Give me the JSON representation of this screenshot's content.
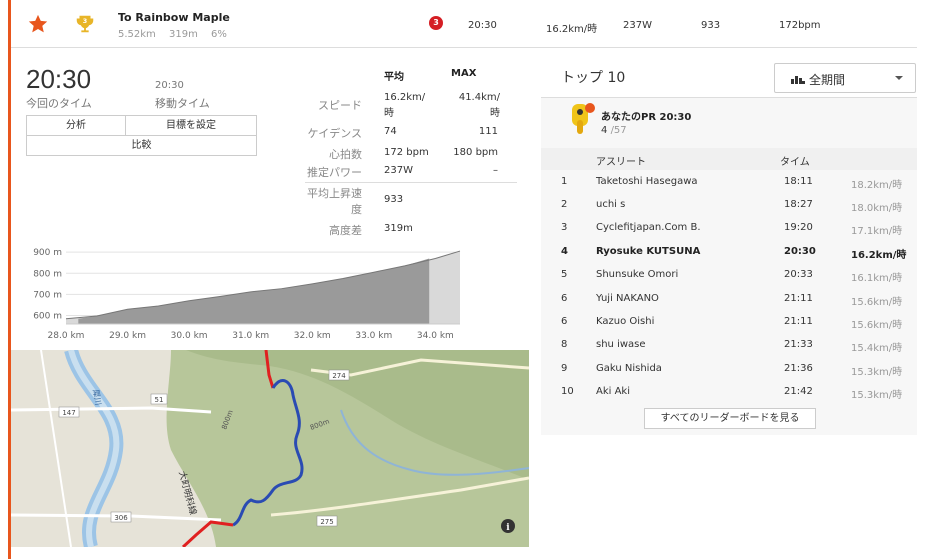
{
  "segment": {
    "name": "To Rainbow Maple",
    "distance": "5.52km",
    "elevation_gain": "319m",
    "grade": "6%",
    "rank": "3",
    "time": "20:30",
    "speed": "16.2km/時",
    "power": "237W",
    "vam": "933",
    "heart_rate": "172bpm"
  },
  "effort": {
    "elapsed_time": "20:30",
    "elapsed_label": "今回のタイム",
    "moving_time": "20:30",
    "moving_label": "移動タイム",
    "buttons": {
      "analysis": "分析",
      "set_goal": "目標を設定",
      "compare": "比較"
    }
  },
  "stats": {
    "header_avg": "平均",
    "header_max": "MAX",
    "rows": [
      {
        "label": "スピード",
        "avg": "16.2km/時",
        "max": "41.4km/時"
      },
      {
        "label": "ケイデンス",
        "avg": "74",
        "max": "111"
      },
      {
        "label": "心拍数",
        "avg": "172 bpm",
        "max": "180 bpm"
      },
      {
        "label": "推定パワー",
        "avg": "237W",
        "max": "–"
      },
      {
        "label": "平均上昇速度",
        "avg": "933",
        "max": ""
      },
      {
        "label": "高度差",
        "avg": "319m",
        "max": ""
      }
    ]
  },
  "chart_data": {
    "type": "area",
    "x": [
      28.0,
      28.5,
      29.0,
      29.5,
      30.0,
      30.5,
      31.0,
      31.5,
      32.0,
      32.5,
      33.0,
      33.5,
      34.0,
      34.4
    ],
    "y": [
      585,
      598,
      630,
      645,
      670,
      690,
      712,
      727,
      750,
      775,
      805,
      835,
      870,
      905
    ],
    "highlight_range": [
      28.2,
      33.9
    ],
    "xlabel": "",
    "ylabel": "",
    "xlim": [
      28.0,
      34.4
    ],
    "ylim": [
      560,
      910
    ],
    "x_ticks": [
      "28.0 km",
      "29.0 km",
      "30.0 km",
      "31.0 km",
      "32.0 km",
      "33.0 km",
      "34.0 km"
    ],
    "y_ticks": [
      "900 m",
      "800 m",
      "700 m",
      "600 m"
    ],
    "grid": true
  },
  "map": {
    "road_labels": [
      "274",
      "147",
      "51",
      "306",
      "275"
    ],
    "contours": [
      "800m",
      "800m"
    ],
    "place_label": "大町明科線",
    "river_label": "犀川"
  },
  "leaderboard": {
    "title": "トップ 10",
    "period": "全期間",
    "pr_title": "あなたのPR 20:30",
    "pr_rank": "4",
    "pr_total": "/57",
    "header_athlete": "アスリート",
    "header_time": "タイム",
    "rows": [
      {
        "rank": "1",
        "name": "Taketoshi Hasegawa",
        "time": "18:11",
        "speed": "18.2km/時",
        "me": false
      },
      {
        "rank": "2",
        "name": "uchi s",
        "time": "18:27",
        "speed": "18.0km/時",
        "me": false
      },
      {
        "rank": "3",
        "name": "Cyclefitjapan.Com B.",
        "time": "19:20",
        "speed": "17.1km/時",
        "me": false
      },
      {
        "rank": "4",
        "name": "Ryosuke KUTSUNA",
        "time": "20:30",
        "speed": "16.2km/時",
        "me": true
      },
      {
        "rank": "5",
        "name": "Shunsuke Omori",
        "time": "20:33",
        "speed": "16.1km/時",
        "me": false
      },
      {
        "rank": "6",
        "name": "Yuji NAKANO",
        "time": "21:11",
        "speed": "15.6km/時",
        "me": false
      },
      {
        "rank": "6",
        "name": "Kazuo Oishi",
        "time": "21:11",
        "speed": "15.6km/時",
        "me": false
      },
      {
        "rank": "8",
        "name": "shu iwase",
        "time": "21:33",
        "speed": "15.4km/時",
        "me": false
      },
      {
        "rank": "9",
        "name": "Gaku Nishida",
        "time": "21:36",
        "speed": "15.3km/時",
        "me": false
      },
      {
        "rank": "10",
        "name": "Aki Aki",
        "time": "21:42",
        "speed": "15.3km/時",
        "me": false
      }
    ],
    "view_all": "すべてのリーダーボードを見る"
  },
  "colors": {
    "accent": "#e8561d",
    "rank_badge": "#d51e24",
    "route": "#2a4bb3",
    "route_out": "#e02020"
  }
}
